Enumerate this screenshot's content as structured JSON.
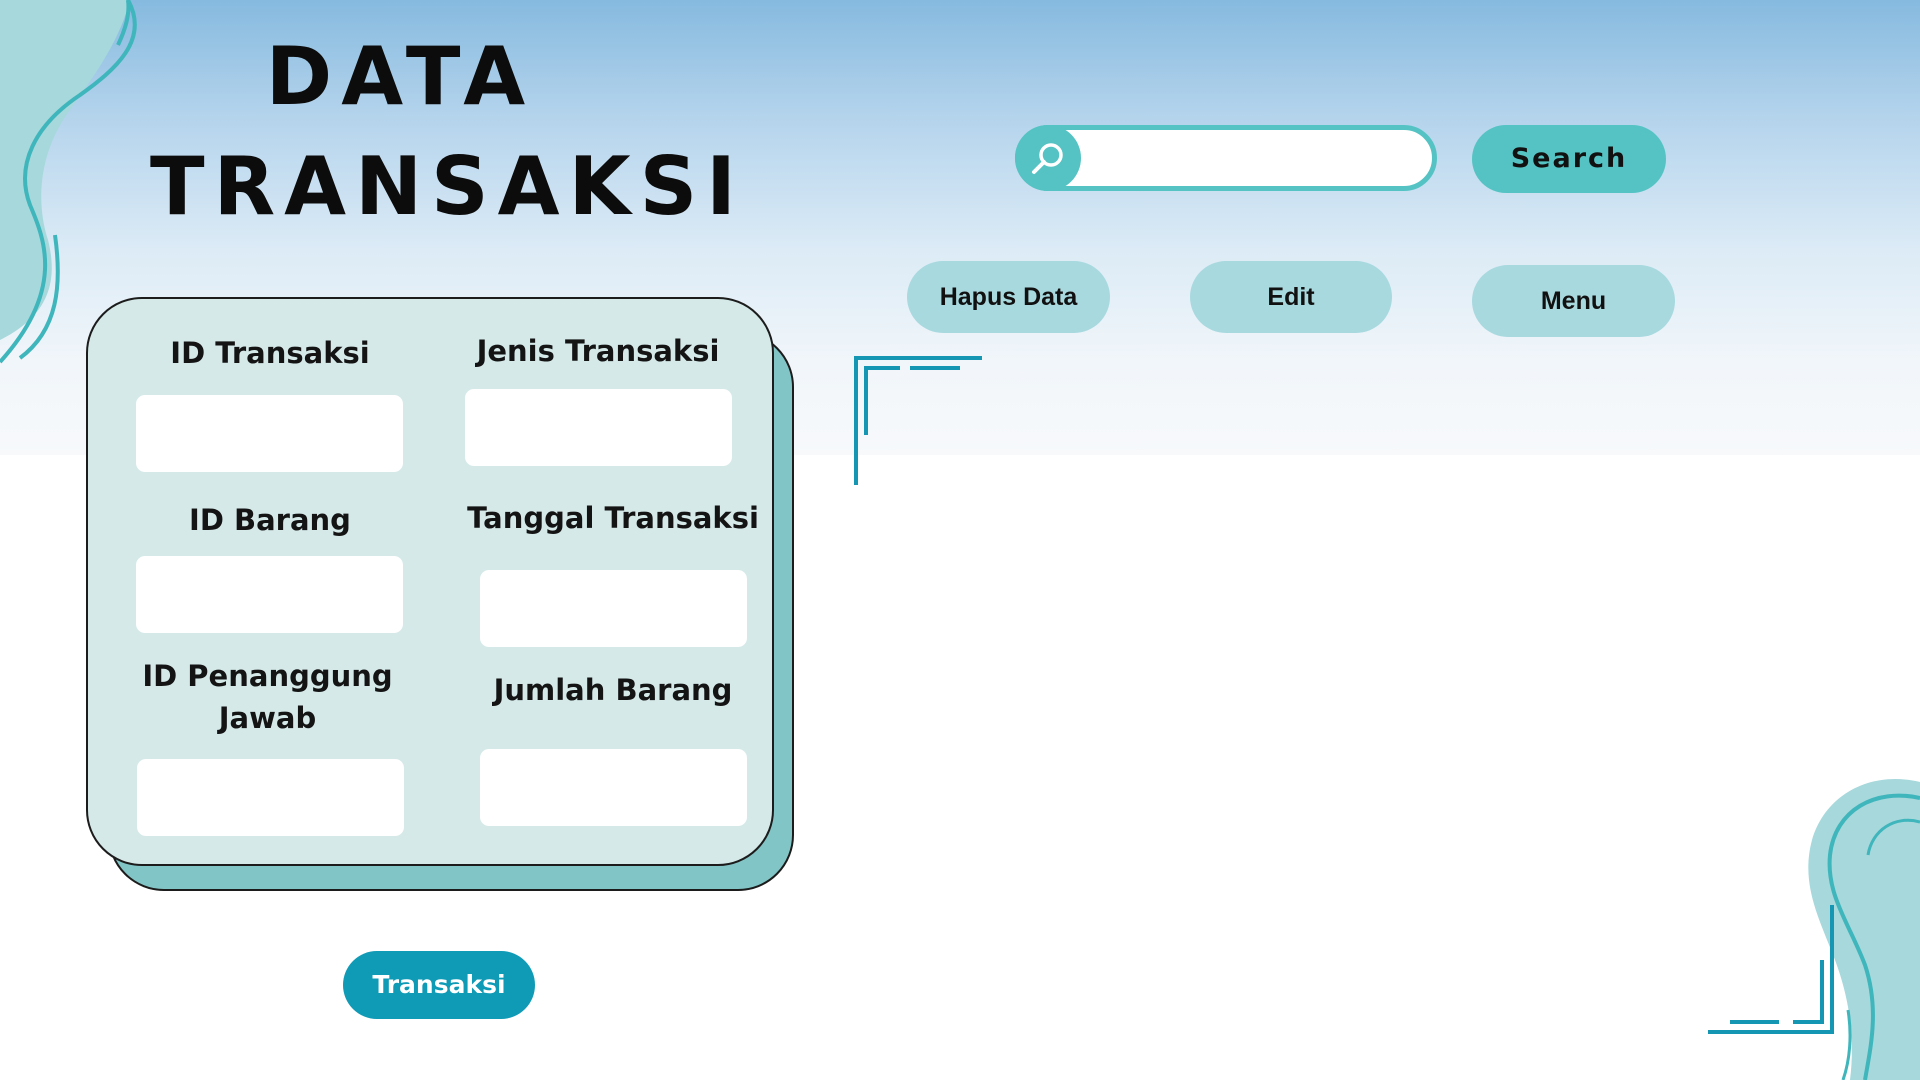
{
  "header": {
    "title_line1": "DATA",
    "title_line2": "TRANSAKSI"
  },
  "search": {
    "value": "",
    "placeholder": "",
    "icon": "search-icon",
    "button_label": "Search"
  },
  "actions": {
    "delete_label": "Hapus Data",
    "edit_label": "Edit",
    "menu_label": "Menu"
  },
  "form": {
    "fields": [
      {
        "label": "ID Transaksi",
        "value": ""
      },
      {
        "label": "Jenis Transaksi",
        "value": ""
      },
      {
        "label": "ID Barang",
        "value": ""
      },
      {
        "label": "Tanggal Transaksi",
        "value": ""
      },
      {
        "label": "ID Penanggung Jawab",
        "value": ""
      },
      {
        "label": "Jumlah Barang",
        "value": ""
      }
    ],
    "submit_label": "Transaksi"
  },
  "colors": {
    "accent": "#55c3c3",
    "pill": "#a8d9df",
    "card": "#d5e9e9",
    "card_shadow": "#82c5c6",
    "submit": "#0f9ab6",
    "bracket": "#1596b3"
  }
}
